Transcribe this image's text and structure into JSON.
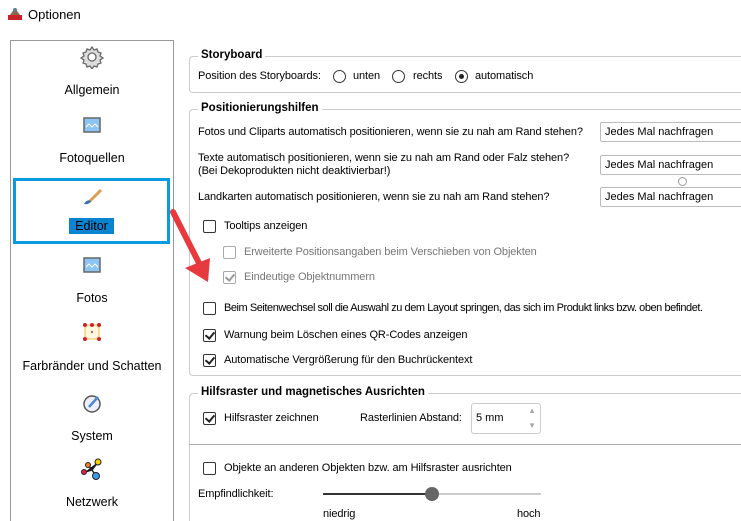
{
  "window": {
    "title": "Optionen"
  },
  "sidebar": {
    "items": [
      {
        "label": "Allgemein",
        "icon": "gear-icon"
      },
      {
        "label": "Fotoquellen",
        "icon": "image-icon"
      },
      {
        "label": "Editor",
        "icon": "brush-icon",
        "selected": true
      },
      {
        "label": "Fotos",
        "icon": "image-icon"
      },
      {
        "label": "Farbränder und Schatten",
        "icon": "frame-icon"
      },
      {
        "label": "System",
        "icon": "system-icon"
      },
      {
        "label": "Netzwerk",
        "icon": "network-icon"
      }
    ]
  },
  "storyboard": {
    "title": "Storyboard",
    "label": "Position des Storyboards:",
    "options": [
      "unten",
      "rechts",
      "automatisch"
    ],
    "selected": "automatisch"
  },
  "positioning": {
    "title": "Positionierungshilfen",
    "rows": [
      {
        "label": "Fotos und Cliparts automatisch positionieren, wenn sie zu nah am Rand stehen?",
        "value": "Jedes Mal nachfragen"
      },
      {
        "label": "Texte automatisch positionieren, wenn sie zu nah am Rand oder Falz stehen?",
        "label2": "(Bei Dekoprodukten nicht deaktivierbar!)",
        "value": "Jedes Mal nachfragen"
      },
      {
        "label": "Landkarten automatisch positionieren, wenn sie zu nah am Rand stehen?",
        "value": "Jedes Mal nachfragen"
      }
    ],
    "checks": [
      {
        "label": "Tooltips anzeigen",
        "checked": false
      },
      {
        "label": "Erweiterte Positionsangaben beim Verschieben von Objekten",
        "checked": false,
        "disabled": true
      },
      {
        "label": "Eindeutige Objektnummern",
        "checked": true,
        "disabled": true
      },
      {
        "label": "Beim Seitenwechsel soll die Auswahl zu dem Layout springen, das sich im Produkt links bzw. oben befindet.",
        "checked": false
      },
      {
        "label": "Warnung beim Löschen eines QR-Codes anzeigen",
        "checked": true
      },
      {
        "label": "Automatische Vergrößerung für den Buchrückentext",
        "checked": true
      }
    ]
  },
  "grid": {
    "title": "Hilfsraster und magnetisches Ausrichten",
    "draw_label": "Hilfsraster zeichnen",
    "draw_checked": true,
    "spacing_label": "Rasterlinien Abstand:",
    "spacing_value": "5 mm",
    "snap_label": "Objekte an anderen Objekten bzw. am Hilfsraster ausrichten",
    "snap_checked": false,
    "sensitivity_label": "Empfindlichkeit:",
    "sensitivity_value": 0.5,
    "low_label": "niedrig",
    "high_label": "hoch"
  },
  "colors": {
    "accent": "#0a9ae0",
    "arrow": "#e8393f"
  }
}
